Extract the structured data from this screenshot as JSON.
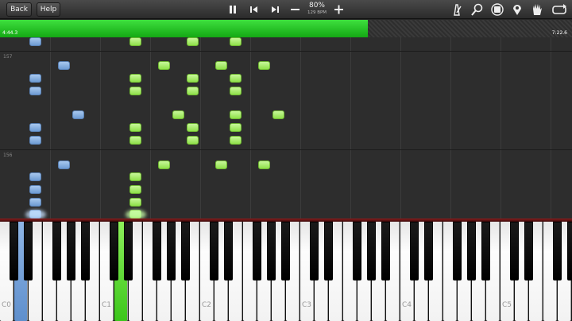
{
  "toolbar": {
    "back_label": "Back",
    "help_label": "Help",
    "speed_percent": "80%",
    "speed_bpm": "129 BPM",
    "icons": [
      "pause-icon",
      "previous-icon",
      "next-icon",
      "minus-icon",
      "plus-icon",
      "metronome-icon",
      "search-icon",
      "label-icon",
      "location-pin-icon",
      "hand-icon",
      "loop-icon"
    ]
  },
  "progress": {
    "elapsed": "4:44.3",
    "total": "7:22.6",
    "fraction": 0.643,
    "fill_color": "#2ecc2e"
  },
  "roll": {
    "measures": [
      "157",
      "156"
    ],
    "left_hand_color": "#8ab4e6",
    "right_hand_color": "#a8ee6c"
  },
  "keyboard": {
    "octave_labels": [
      "C0",
      "C1",
      "C2",
      "C3",
      "C4",
      "C5"
    ],
    "active_left_key": "D0",
    "active_right_key": "D1"
  }
}
